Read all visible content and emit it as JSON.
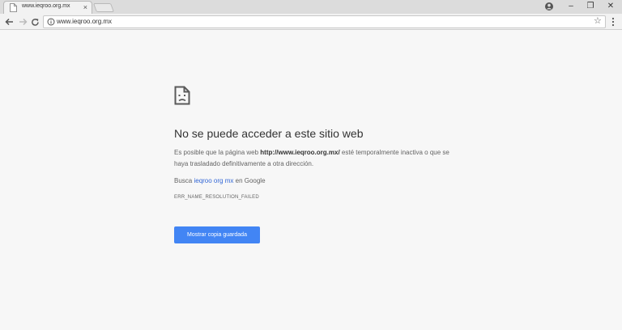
{
  "tab": {
    "title": "www.ieqroo.org.mx",
    "close_label": "×"
  },
  "window": {
    "minimize": "–",
    "maximize": "❐",
    "close": "✕"
  },
  "omnibox": {
    "url": "www.ieqroo.org.mx"
  },
  "error": {
    "title": "No se puede acceder a este sitio web",
    "desc_pre": "Es posible que la página web ",
    "desc_url": "http://www.ieqroo.org.mx/",
    "desc_post": " esté temporalmente inactiva o que se haya trasladado definitivamente a otra dirección.",
    "suggest_pre": "Busca ",
    "suggest_link": "ieqroo org mx",
    "suggest_post": " en Google",
    "code": "ERR_NAME_RESOLUTION_FAILED",
    "button_label": "Mostrar copia guardada"
  },
  "colors": {
    "button": "#4285f4",
    "link": "#3367d6",
    "background": "#f7f7f7"
  },
  "icons": [
    "page-icon",
    "close-icon",
    "profile-icon",
    "back-icon",
    "forward-icon",
    "reload-icon",
    "info-icon",
    "star-icon",
    "menu-icon",
    "sad-page-icon"
  ]
}
